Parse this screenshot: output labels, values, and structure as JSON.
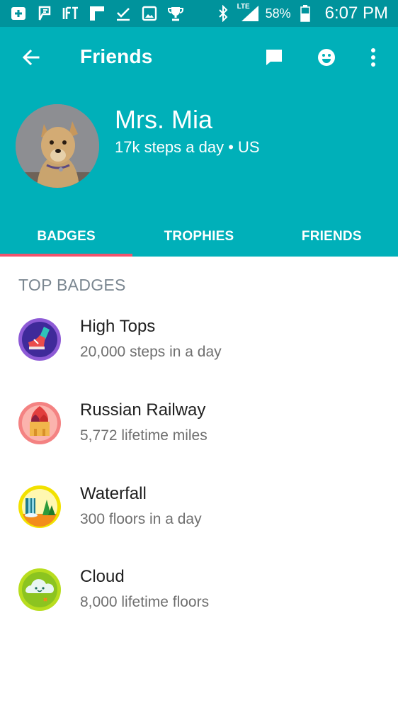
{
  "status_bar": {
    "network": "LTE",
    "battery": "58%",
    "time": "6:07 PM",
    "notification_icons": [
      "add-box-icon",
      "flag-icon",
      "ift-icon",
      "flipboard-icon",
      "checkmark-icon",
      "image-icon",
      "trophy-icon"
    ]
  },
  "toolbar": {
    "title": "Friends"
  },
  "profile": {
    "name": "Mrs. Mia",
    "subtitle": "17k steps a day • US"
  },
  "tabs": [
    {
      "label": "BADGES",
      "active": true
    },
    {
      "label": "TROPHIES",
      "active": false
    },
    {
      "label": "FRIENDS",
      "active": false
    }
  ],
  "section": {
    "title": "TOP BADGES"
  },
  "badges": [
    {
      "name": "High Tops",
      "description": "20,000 steps in a day",
      "icon": "sneaker-badge-icon"
    },
    {
      "name": "Russian Railway",
      "description": "5,772 lifetime miles",
      "icon": "kremlin-badge-icon"
    },
    {
      "name": "Waterfall",
      "description": "300 floors in a day",
      "icon": "waterfall-badge-icon"
    },
    {
      "name": "Cloud",
      "description": "8,000 lifetime floors",
      "icon": "cloud-badge-icon"
    }
  ],
  "colors": {
    "status_bar": "#00939c",
    "header": "#00b0b9",
    "tab_indicator": "#f2536c",
    "section_title": "#7b8791"
  }
}
